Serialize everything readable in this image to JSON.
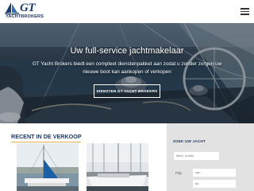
{
  "header": {
    "logo_main": "GT",
    "logo_sub": "YACHTBROKERS",
    "menu_icon": "hamburger-menu-icon"
  },
  "hero": {
    "title": "Uw full-service jachtmakelaar",
    "text": "GT Yacht Brokers biedt een compleet dienstenpakket aan zodat u zonder zorgen uw nieuwe boot kan aankopen of verkopen",
    "button_label": "DIENSTEN GT YACHT BROKERS"
  },
  "recent": {
    "title": "RECENT IN DE VERKOOP"
  },
  "search": {
    "title": "ZOEK UW JACHT",
    "merk_placeholder": "Merk, model",
    "prijs_label": "Prijs",
    "van_placeholder": "van",
    "tot_placeholder": "tot"
  },
  "colors": {
    "brand_navy": "#1c3a66",
    "accent_gold": "#e0b24a",
    "panel_gray": "#e2e2e2"
  }
}
